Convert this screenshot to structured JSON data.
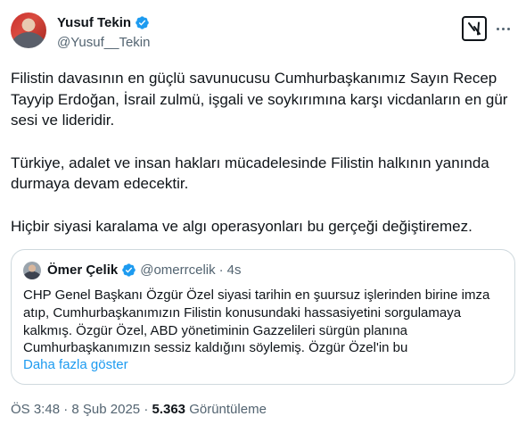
{
  "author": {
    "display_name": "Yusuf Tekin",
    "handle": "@Yusuf__Tekin",
    "verified_icon": "verified-badge-icon"
  },
  "actions": {
    "grok_icon": "grok-icon",
    "more_icon": "more-options-icon"
  },
  "tweet": {
    "paragraphs": [
      "Filistin davasının en güçlü savunucusu Cumhurbaşkanımız Sayın Recep Tayyip Erdoğan, İsrail zulmü, işgali ve soykırımına karşı vicdanların en gür sesi ve lideridir.",
      "Türkiye, adalet ve insan hakları mücadelesinde Filistin halkının yanında durmaya devam edecektir.",
      "Hiçbir siyasi karalama ve algı operasyonları bu gerçeği değiştiremez."
    ]
  },
  "quote": {
    "display_name": "Ömer Çelik",
    "handle": "@omerrcelik",
    "separator": "·",
    "time": "4s",
    "text": "CHP Genel Başkanı Özgür Özel siyasi tarihin en şuursuz işlerinden birine imza atıp, Cumhurbaşkanımızın Filistin konusundaki hassasiyetini sorgulamaya kalkmış. Özgür Özel, ABD yönetiminin Gazzelileri sürgün planına Cumhurbaşkanımızın sessiz kaldığını söylemiş. Özgür Özel'in bu",
    "show_more": "Daha fazla göster"
  },
  "meta": {
    "time": "ÖS 3:48",
    "separator": "·",
    "date": "8 Şub 2025",
    "views_count": "5.363",
    "views_label": "Görüntüleme"
  },
  "colors": {
    "text": "#0f1419",
    "secondary": "#536471",
    "link": "#1d9bf0",
    "verified": "#1d9bf0",
    "border": "#cfd9de"
  }
}
